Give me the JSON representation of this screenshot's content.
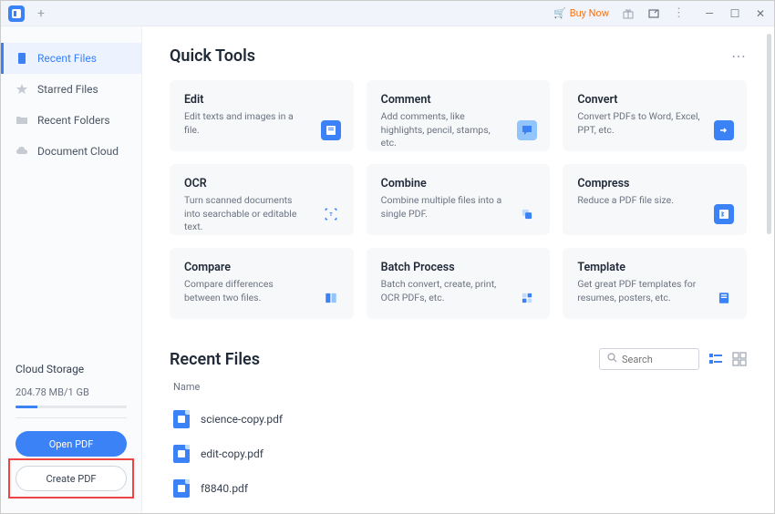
{
  "titlebar": {
    "buy_now": "Buy Now"
  },
  "sidebar": {
    "items": [
      {
        "label": "Recent Files"
      },
      {
        "label": "Starred Files"
      },
      {
        "label": "Recent Folders"
      },
      {
        "label": "Document Cloud"
      }
    ],
    "cloud": {
      "title": "Cloud Storage",
      "usage": "204.78 MB/1 GB"
    },
    "open_btn": "Open PDF",
    "create_btn": "Create PDF"
  },
  "quick_tools": {
    "title": "Quick Tools",
    "cards": [
      {
        "title": "Edit",
        "desc": "Edit texts and images in a file."
      },
      {
        "title": "Comment",
        "desc": "Add comments, like highlights, pencil, stamps, etc."
      },
      {
        "title": "Convert",
        "desc": "Convert PDFs to Word, Excel, PPT, etc."
      },
      {
        "title": "OCR",
        "desc": "Turn scanned documents into searchable or editable text."
      },
      {
        "title": "Combine",
        "desc": "Combine multiple files into a single PDF."
      },
      {
        "title": "Compress",
        "desc": "Reduce a PDF file size."
      },
      {
        "title": "Compare",
        "desc": "Compare differences between two files."
      },
      {
        "title": "Batch Process",
        "desc": "Batch convert, create, print, OCR PDFs, etc."
      },
      {
        "title": "Template",
        "desc": "Get great PDF templates for resumes, posters, etc."
      }
    ]
  },
  "recent": {
    "title": "Recent Files",
    "search_placeholder": "Search",
    "col_name": "Name",
    "files": [
      {
        "name": "science-copy.pdf"
      },
      {
        "name": "edit-copy.pdf"
      },
      {
        "name": "f8840.pdf"
      }
    ]
  }
}
